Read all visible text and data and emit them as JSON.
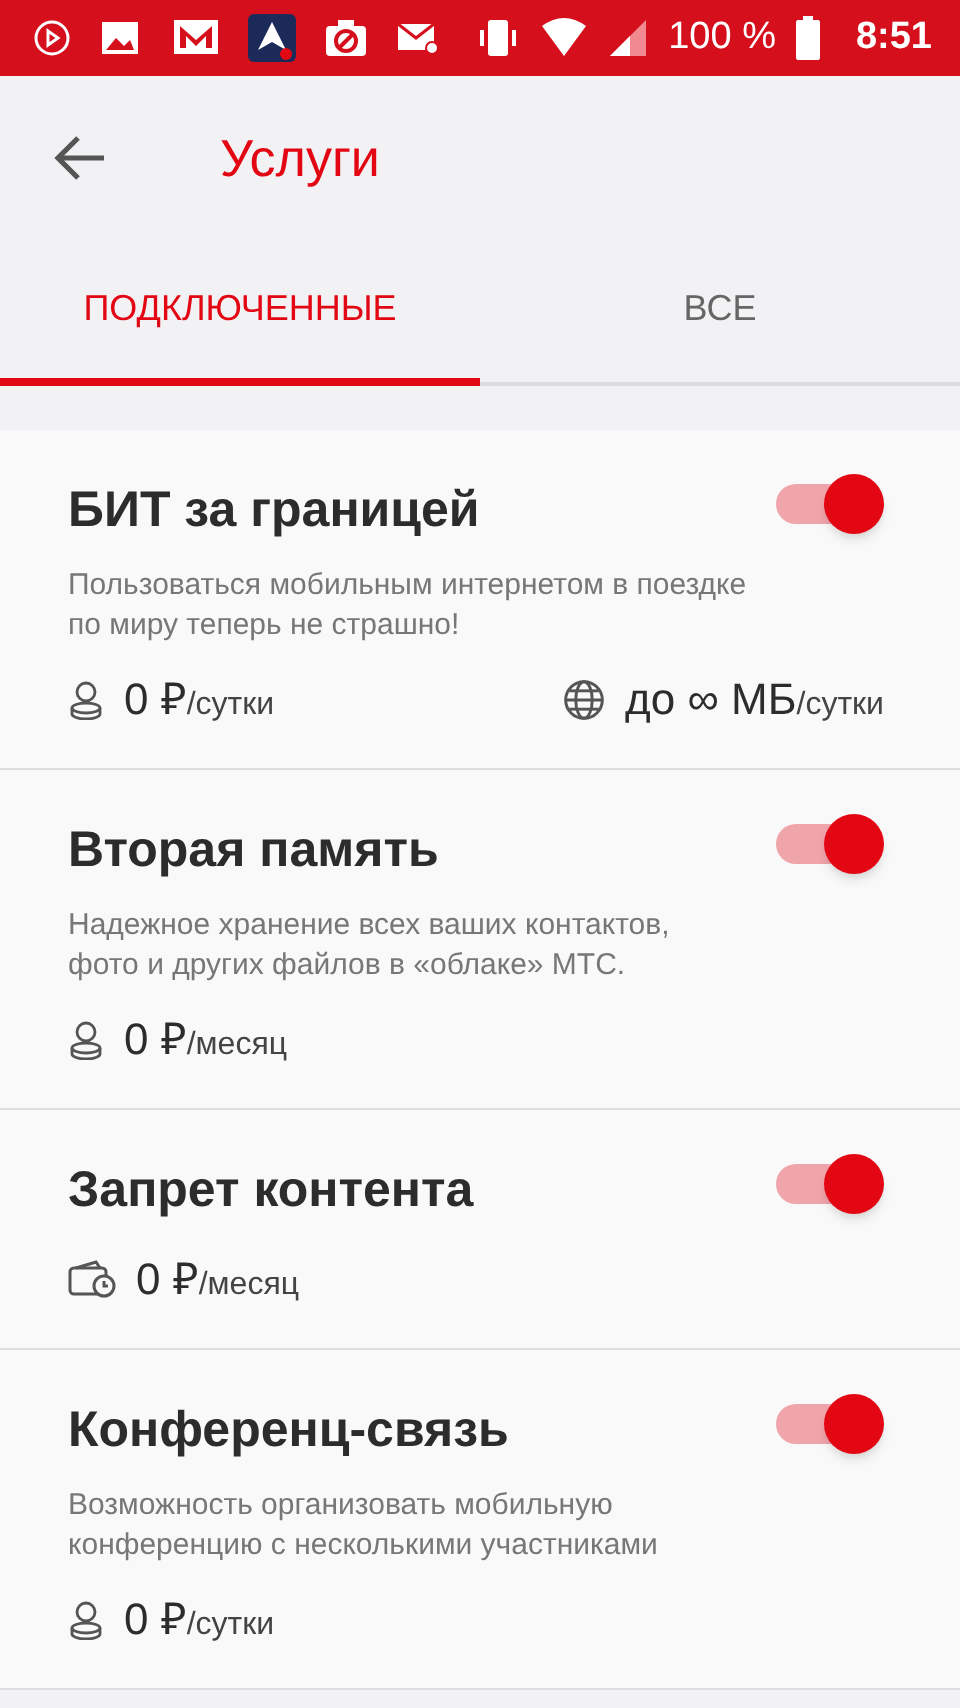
{
  "status_bar": {
    "battery": "100 %",
    "time": "8:51"
  },
  "header": {
    "title": "Услуги"
  },
  "tabs": [
    {
      "label": "ПОДКЛЮЧЕННЫЕ",
      "selected": true
    },
    {
      "label": "ВСЕ",
      "selected": false
    }
  ],
  "services": [
    {
      "title": "БИТ за границей",
      "on": true,
      "description": "Пользоваться мобильным интернетом в поездке по миру теперь не страшно!",
      "prices": [
        {
          "kind": "coins",
          "amount": "0 ₽",
          "unit": "/сутки"
        },
        {
          "kind": "globe",
          "amount": "до ∞ МБ",
          "unit": "/сутки"
        }
      ]
    },
    {
      "title": "Вторая память",
      "on": true,
      "description": "Надежное хранение всех ваших контактов, фото и других файлов в «облаке» МТС.",
      "prices": [
        {
          "kind": "coins",
          "amount": "0 ₽",
          "unit": "/месяц"
        }
      ]
    },
    {
      "title": "Запрет контента",
      "on": true,
      "prices": [
        {
          "kind": "wallet",
          "amount": "0 ₽",
          "unit": "/месяц"
        }
      ]
    },
    {
      "title": "Конференц-связь",
      "on": true,
      "description": "Возможность организовать мобильную конференцию с несколькими участниками",
      "prices": [
        {
          "kind": "coins",
          "amount": "0 ₽",
          "unit": "/сутки"
        }
      ]
    }
  ]
}
